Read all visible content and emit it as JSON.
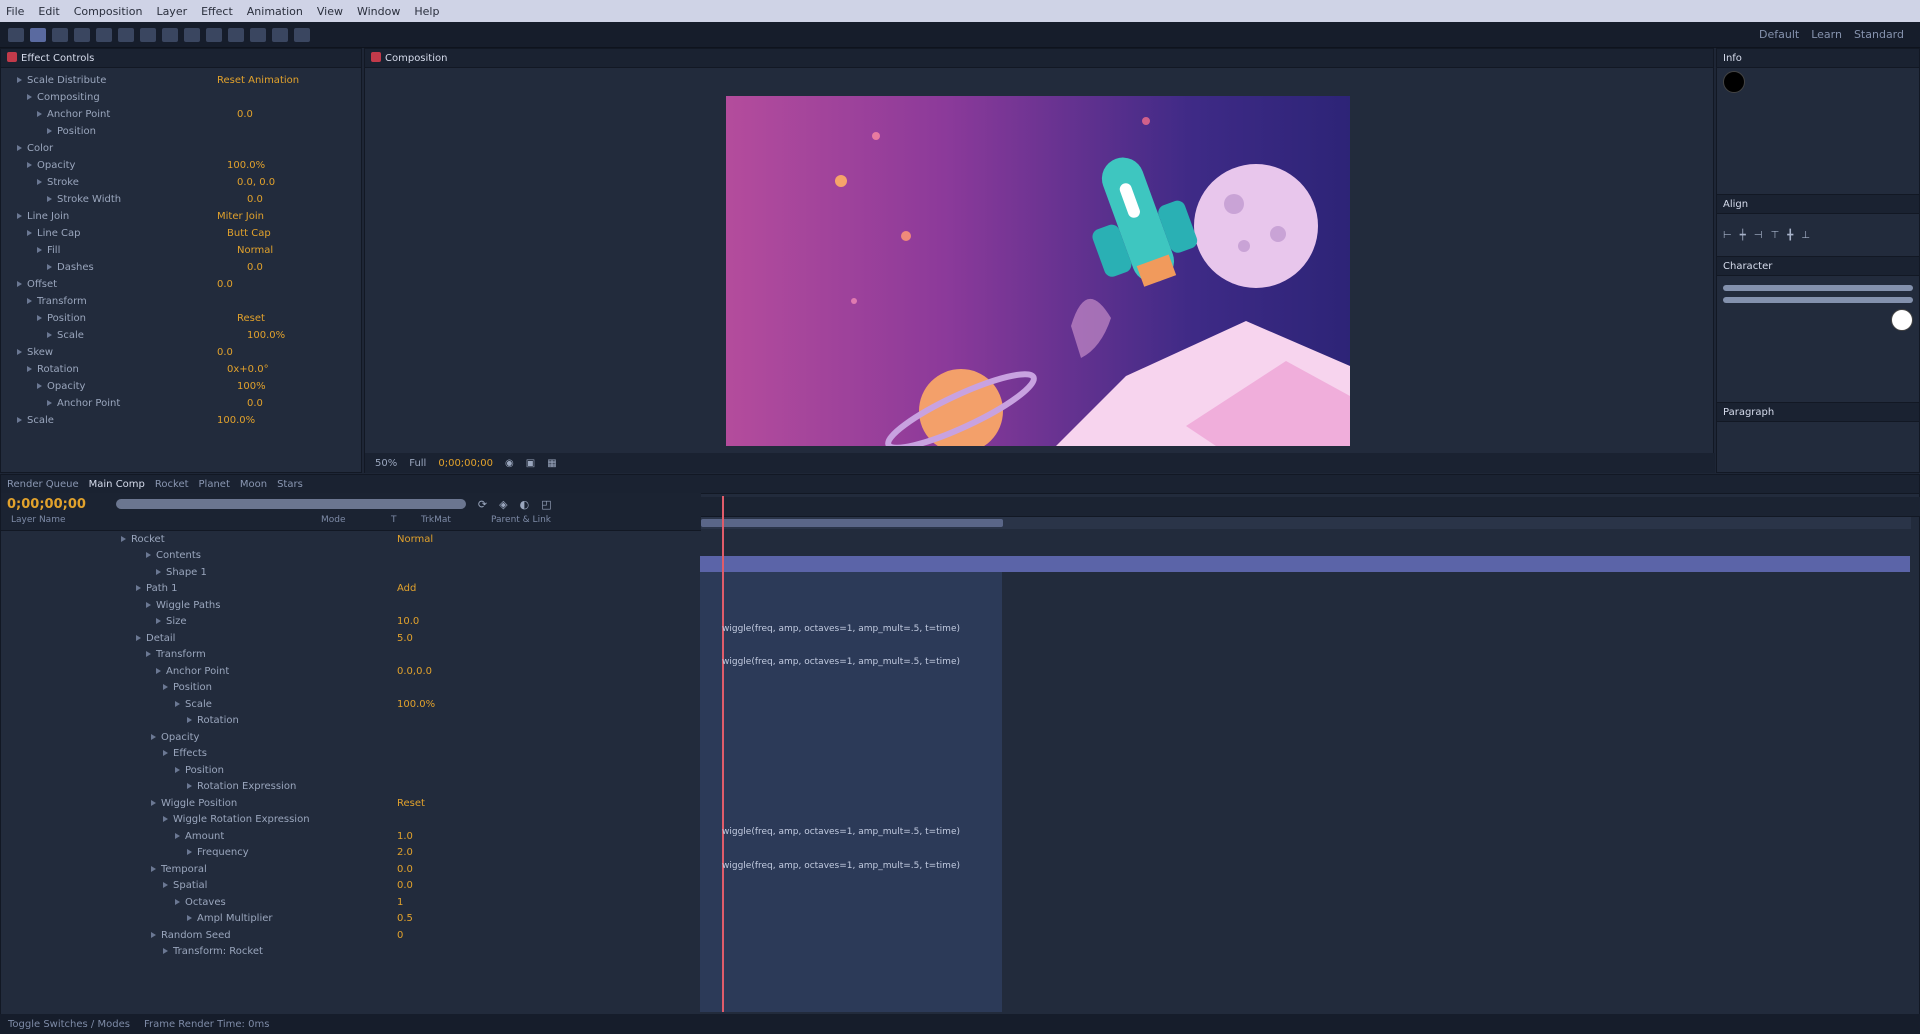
{
  "menubar": {
    "items": [
      "File",
      "Edit",
      "Composition",
      "Layer",
      "Effect",
      "Animation",
      "View",
      "Window",
      "Help"
    ]
  },
  "workspace": {
    "items": [
      "Default",
      "Learn",
      "Standard"
    ]
  },
  "effect_controls": {
    "tab_label": "Effect Controls",
    "rows": [
      {
        "label": "Scale Distribute",
        "value": "Reset  Animation"
      },
      {
        "label": "Compositing",
        "value": ""
      },
      {
        "label": "Anchor Point",
        "value": "0.0"
      },
      {
        "label": "Position",
        "value": ""
      },
      {
        "label": "Color",
        "value": ""
      },
      {
        "label": "Opacity",
        "value": "100.0%"
      },
      {
        "label": "Stroke",
        "value": "0.0, 0.0"
      },
      {
        "label": "Stroke Width",
        "value": "0.0"
      },
      {
        "label": "Line Join",
        "value": "Miter Join"
      },
      {
        "label": "Line Cap",
        "value": "Butt Cap"
      },
      {
        "label": "Fill",
        "value": "Normal"
      },
      {
        "label": "Dashes",
        "value": "0.0"
      },
      {
        "label": "Offset",
        "value": "0.0"
      },
      {
        "label": "Transform",
        "value": ""
      },
      {
        "label": "Position",
        "value": "Reset"
      },
      {
        "label": "Scale",
        "value": "100.0%"
      },
      {
        "label": "Skew",
        "value": "0.0"
      },
      {
        "label": "Rotation",
        "value": "0x+0.0°"
      },
      {
        "label": "Opacity",
        "value": "100%"
      },
      {
        "label": "Anchor Point",
        "value": "0.0"
      },
      {
        "label": "Scale",
        "value": "100.0%"
      }
    ]
  },
  "composition": {
    "tab_label": "Composition",
    "footer": {
      "zoom": "50%",
      "quality": "Full",
      "timecode": "0;00;00;00"
    }
  },
  "right_panel": {
    "info_label": "Info",
    "align_label": "Align",
    "character_label": "Character",
    "paragraph_label": "Paragraph"
  },
  "timeline": {
    "timecode": "0;00;00;00",
    "tabs": [
      "Render Queue",
      "Main Comp",
      "Rocket",
      "Planet",
      "Moon",
      "Stars"
    ],
    "columns": [
      "Layer Name",
      "Mode",
      "T",
      "TrkMat",
      "Parent & Link"
    ],
    "layers": [
      {
        "name": "Rocket",
        "value": "Normal"
      },
      {
        "name": "Contents",
        "value": ""
      },
      {
        "name": "Shape 1",
        "value": ""
      },
      {
        "name": "Path 1",
        "value": "Add"
      },
      {
        "name": "Wiggle Paths",
        "value": ""
      },
      {
        "name": "Size",
        "value": "10.0"
      },
      {
        "name": "Detail",
        "value": "5.0"
      },
      {
        "name": "Transform",
        "value": ""
      },
      {
        "name": "Anchor Point",
        "value": "0.0,0.0"
      },
      {
        "name": "Position",
        "value": ""
      },
      {
        "name": "Scale",
        "value": "100.0%"
      },
      {
        "name": "Rotation",
        "value": ""
      },
      {
        "name": "Opacity",
        "value": ""
      },
      {
        "name": "Effects",
        "value": ""
      },
      {
        "name": "Position",
        "value": ""
      },
      {
        "name": "Rotation Expression",
        "value": ""
      },
      {
        "name": "Wiggle Position",
        "value": "Reset"
      },
      {
        "name": "Wiggle Rotation Expression",
        "value": ""
      },
      {
        "name": "Amount",
        "value": "1.0"
      },
      {
        "name": "Frequency",
        "value": "2.0"
      },
      {
        "name": "Temporal",
        "value": "0.0"
      },
      {
        "name": "Spatial",
        "value": "0.0"
      },
      {
        "name": "Octaves",
        "value": "1"
      },
      {
        "name": "Ampl Multiplier",
        "value": "0.5"
      },
      {
        "name": "Random Seed",
        "value": "0"
      },
      {
        "name": "Transform: Rocket",
        "value": ""
      }
    ],
    "expression_text": "wiggle(freq, amp, octaves=1, amp_mult=.5, t=time)"
  },
  "status": {
    "items": [
      "Toggle Switches / Modes",
      "Frame Render Time: 0ms"
    ]
  },
  "colors": {
    "accent": "#e2a22c",
    "playhead": "#e05c6a",
    "layer_bar": "#5b64a8"
  }
}
